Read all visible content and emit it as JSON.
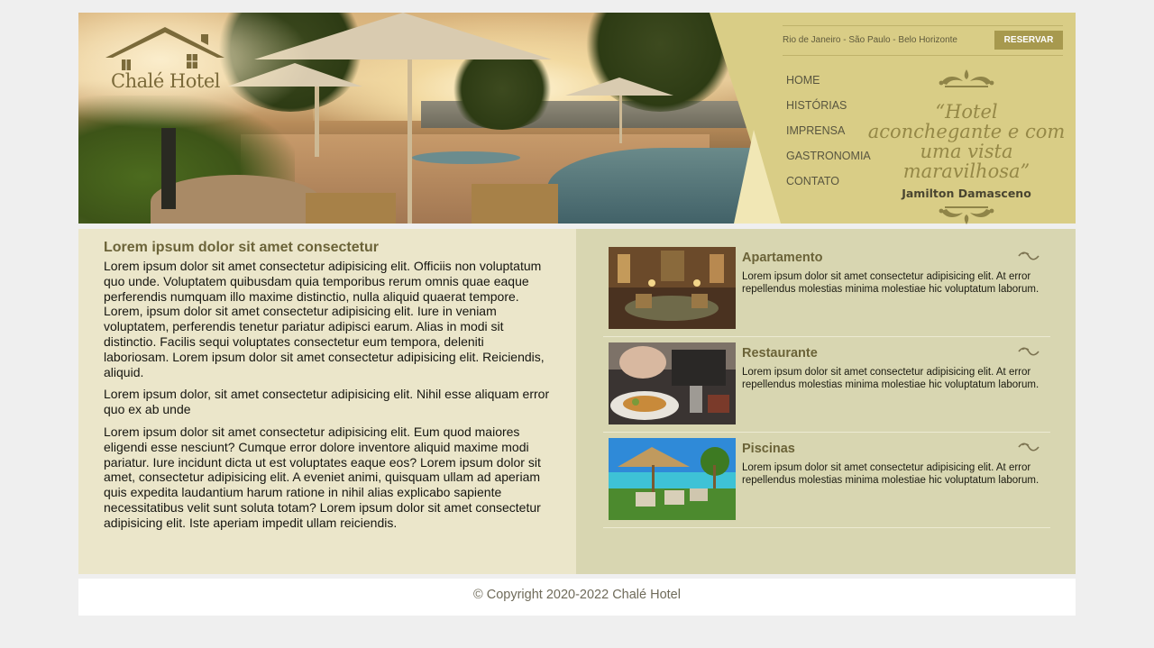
{
  "brand": {
    "name": "Chalé Hotel"
  },
  "header": {
    "cities": "Rio de Janeiro - São Paulo - Belo Horizonte",
    "reserve_label": "RESERVAR",
    "nav": [
      {
        "label": "HOME"
      },
      {
        "label": "HISTÓRIAS"
      },
      {
        "label": "IMPRENSA"
      },
      {
        "label": "GASTRONOMIA"
      },
      {
        "label": "CONTATO"
      }
    ],
    "quote": "“Hotel aconchegante e com uma vista maravilhosa”",
    "quote_author": "Jamilton Damasceno"
  },
  "main": {
    "title": "Lorem ipsum dolor sit amet consectetur",
    "paragraphs": [
      "Lorem ipsum dolor sit amet consectetur adipisicing elit. Officiis non voluptatum quo unde. Voluptatem quibusdam quia temporibus rerum omnis quae eaque perferendis numquam illo maxime distinctio, nulla aliquid quaerat tempore. Lorem, ipsum dolor sit amet consectetur adipisicing elit. Iure in veniam voluptatem, perferendis tenetur pariatur adipisci earum. Alias in modi sit distinctio. Facilis sequi voluptates consectetur eum tempora, deleniti laboriosam. Lorem ipsum dolor sit amet consectetur adipisicing elit. Reiciendis, aliquid.",
      "Lorem ipsum dolor, sit amet consectetur adipisicing elit. Nihil esse aliquam error quo ex ab unde",
      "Lorem ipsum dolor sit amet consectetur adipisicing elit. Eum quod maiores eligendi esse nesciunt? Cumque error dolore inventore aliquid maxime modi pariatur. Iure incidunt dicta ut est voluptates eaque eos? Lorem ipsum dolor sit amet, consectetur adipisicing elit. A eveniet animi, quisquam ullam ad aperiam quis expedita laudantium harum ratione in nihil alias explicabo sapiente necessitatibus velit sunt soluta totam? Lorem ipsum dolor sit amet consectetur adipisicing elit. Iste aperiam impedit ullam reiciendis."
    ]
  },
  "sidebar": {
    "cards": [
      {
        "title": "Apartamento",
        "desc": "Lorem ipsum dolor sit amet consectetur adipisicing elit. At error repellendus molestias minima molestiae hic voluptatum laborum."
      },
      {
        "title": "Restaurante",
        "desc": "Lorem ipsum dolor sit amet consectetur adipisicing elit. At error repellendus molestias minima molestiae hic voluptatum laborum."
      },
      {
        "title": "Piscinas",
        "desc": "Lorem ipsum dolor sit amet consectetur adipisicing elit. At error repellendus molestias minima molestiae hic voluptatum laborum."
      }
    ]
  },
  "footer": {
    "copyright": "© Copyright 2020-2022 Chalé Hotel"
  },
  "colors": {
    "accent": "#a7994e",
    "header_bg": "#d9cd86",
    "content_bg": "#ebe6ca",
    "sidebar_bg": "#d8d6b1",
    "title": "#6b6338"
  },
  "icons": [
    "house-roof-logo-icon",
    "ornament-flourish-icon",
    "squiggle-icon"
  ]
}
